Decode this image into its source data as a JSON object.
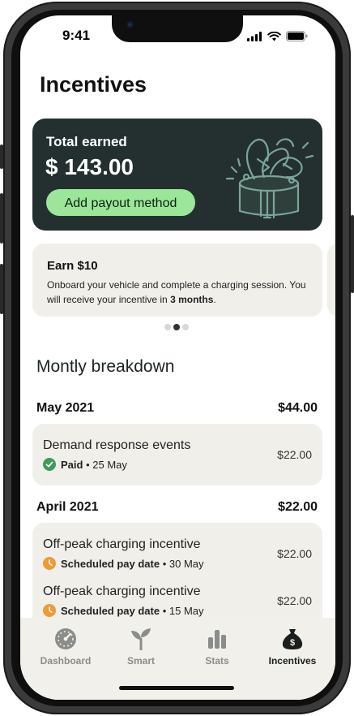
{
  "status": {
    "time": "9:41"
  },
  "page": {
    "title": "Incentives"
  },
  "earned": {
    "label": "Total earned",
    "amount": "$ 143.00",
    "button_label": "Add payout method"
  },
  "promo": {
    "title": "Earn $10",
    "text_before": "Onboard your vehicle and complete a charging session. You will receive your incentive in ",
    "text_bold": "3 months",
    "text_after": ".",
    "pagination": {
      "count": 3,
      "active_index": 1
    }
  },
  "breakdown": {
    "title": "Montly breakdown",
    "months": [
      {
        "label": "May 2021",
        "total": "$44.00",
        "items": [
          {
            "title": "Demand response events",
            "status": "Paid",
            "status_type": "paid",
            "date": "25 May",
            "amount": "$22.00"
          }
        ]
      },
      {
        "label": "April 2021",
        "total": "$22.00",
        "items": [
          {
            "title": "Off-peak charging incentive",
            "status": "Scheduled pay date",
            "status_type": "scheduled",
            "date": "30 May",
            "amount": "$22.00"
          },
          {
            "title": "Off-peak charging incentive",
            "status": "Scheduled pay date",
            "status_type": "scheduled",
            "date": "15 May",
            "amount": "$22.00"
          }
        ]
      }
    ]
  },
  "tabs": [
    {
      "label": "Dashboard",
      "icon": "gauge-icon",
      "active": false
    },
    {
      "label": "Smart",
      "icon": "sprout-icon",
      "active": false
    },
    {
      "label": "Stats",
      "icon": "bar-chart-icon",
      "active": false
    },
    {
      "label": "Incentives",
      "icon": "money-bag-icon",
      "active": true
    }
  ],
  "colors": {
    "card_dark": "#23302f",
    "accent_green": "#9be699",
    "paid_green": "#3e9b57",
    "scheduled_orange": "#ef9a37",
    "surface": "#f0efea"
  }
}
